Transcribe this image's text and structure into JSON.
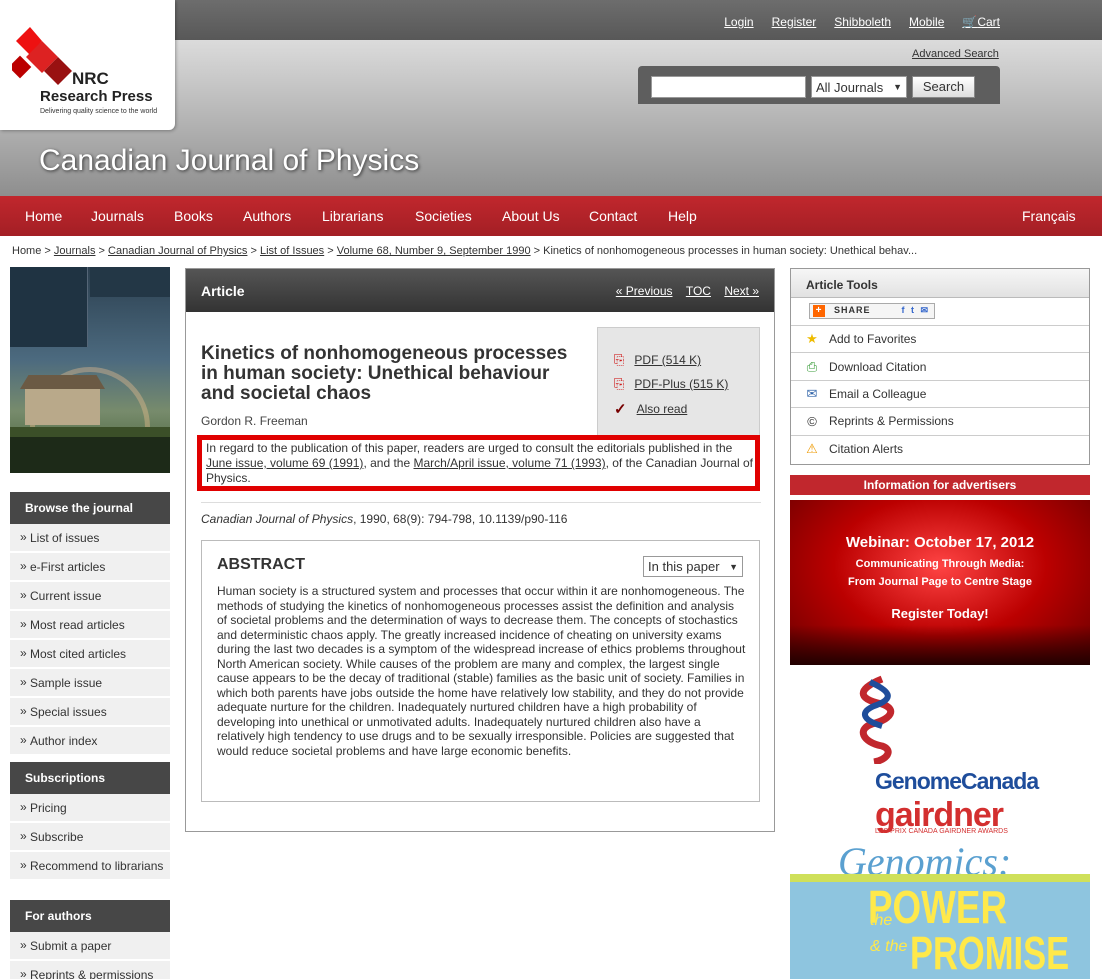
{
  "header": {
    "links": [
      "Login",
      "Register",
      "Shibboleth",
      "Mobile",
      "Cart"
    ],
    "advanced_search": "Advanced Search",
    "search_select": "All Journals",
    "search_button": "Search",
    "journal_title": "Canadian Journal of Physics",
    "logo_text1": "NRC",
    "logo_text2": "Research Press",
    "logo_tagline": "Delivering quality science to the world"
  },
  "nav": [
    "Home",
    "Journals",
    "Books",
    "Authors",
    "Librarians",
    "Societies",
    "About Us",
    "Contact",
    "Help"
  ],
  "nav_lang": "Français",
  "breadcrumb": {
    "items": [
      "Home",
      "Journals",
      "Canadian Journal of Physics",
      "List of Issues",
      "Volume 68, Number 9, September 1990"
    ],
    "current": "Kinetics of nonhomogeneous processes in human society: Unethical behav..."
  },
  "sidebar": {
    "browse_title": "Browse the journal",
    "browse": [
      "List of issues",
      "e-First articles",
      "Current issue",
      "Most read articles",
      "Most cited articles",
      "Sample issue",
      "Special issues",
      "Author index"
    ],
    "subs_title": "Subscriptions",
    "subs": [
      "Pricing",
      "Subscribe",
      "Recommend to librarians"
    ],
    "authors_title": "For authors",
    "authors": [
      "Submit a paper",
      "Reprints & permissions"
    ]
  },
  "article": {
    "header": "Article",
    "prev": "« Previous",
    "toc": "TOC",
    "next": "Next »",
    "title": "Kinetics of nonhomogeneous processes in human society: Unethical behaviour and societal chaos",
    "author": "Gordon R. Freeman",
    "pdf": "PDF (514 K)",
    "pdfplus": "PDF-Plus (515 K)",
    "also_read": "Also read",
    "notice_pre": "In regard to the publication of this paper, readers are urged to consult the editorials published in the ",
    "notice_link1": "June issue, volume 69 (1991)",
    "notice_mid": ", and the ",
    "notice_link2": "March/April issue, volume 71 (1993)",
    "notice_post": ", of the Canadian Journal of Physics.",
    "cite_journal": "Canadian Journal of Physics",
    "cite_rest": ", 1990, 68(9): 794-798, 10.1139/p90-116",
    "abstract_title": "ABSTRACT",
    "abstract_select": "In this paper",
    "abstract": "Human society is a structured system and processes that occur within it are nonhomogeneous. The methods of studying the kinetics of nonhomogeneous processes assist the definition and analysis of societal problems and the determination of ways to decrease them. The concepts of stochastics and deterministic chaos apply. The greatly increased incidence of cheating on university exams during the last two decades is a symptom of the widespread increase of ethics problems throughout North American society. While causes of the problem are many and complex, the largest single cause appears to be the decay of traditional (stable) families as the basic unit of society. Families in which both parents have jobs outside the home have relatively low stability, and they do not provide adequate nurture for the children. Inadequately nurtured children have a high probability of developing into unethical or unmotivated adults. Inadequately nurtured children also have a relatively high tendency to use drugs and to be sexually irresponsible. Policies are suggested that would reduce societal problems and have large economic benefits."
  },
  "tools": {
    "title": "Article Tools",
    "share": "SHARE",
    "items": [
      "Add to Favorites",
      "Download Citation",
      "Email a Colleague",
      "Reprints & Permissions",
      "Citation Alerts"
    ]
  },
  "ads": {
    "bar": "Information for advertisers",
    "webinar": "Webinar: October 17, 2012",
    "webinar_sub1": "Communicating Through Media:",
    "webinar_sub2": "From Journal Page to Centre Stage",
    "webinar_cta": "Register Today!",
    "genome": "GenomeCanada",
    "gairdner": "gairdner",
    "gairdner_sub": "LES PRIX CANADA GAIRDNER AWARDS",
    "genomics": "Genomics:",
    "power": "POWER",
    "promise": "PROMISE",
    "the1": "the",
    "the2": "& the"
  }
}
